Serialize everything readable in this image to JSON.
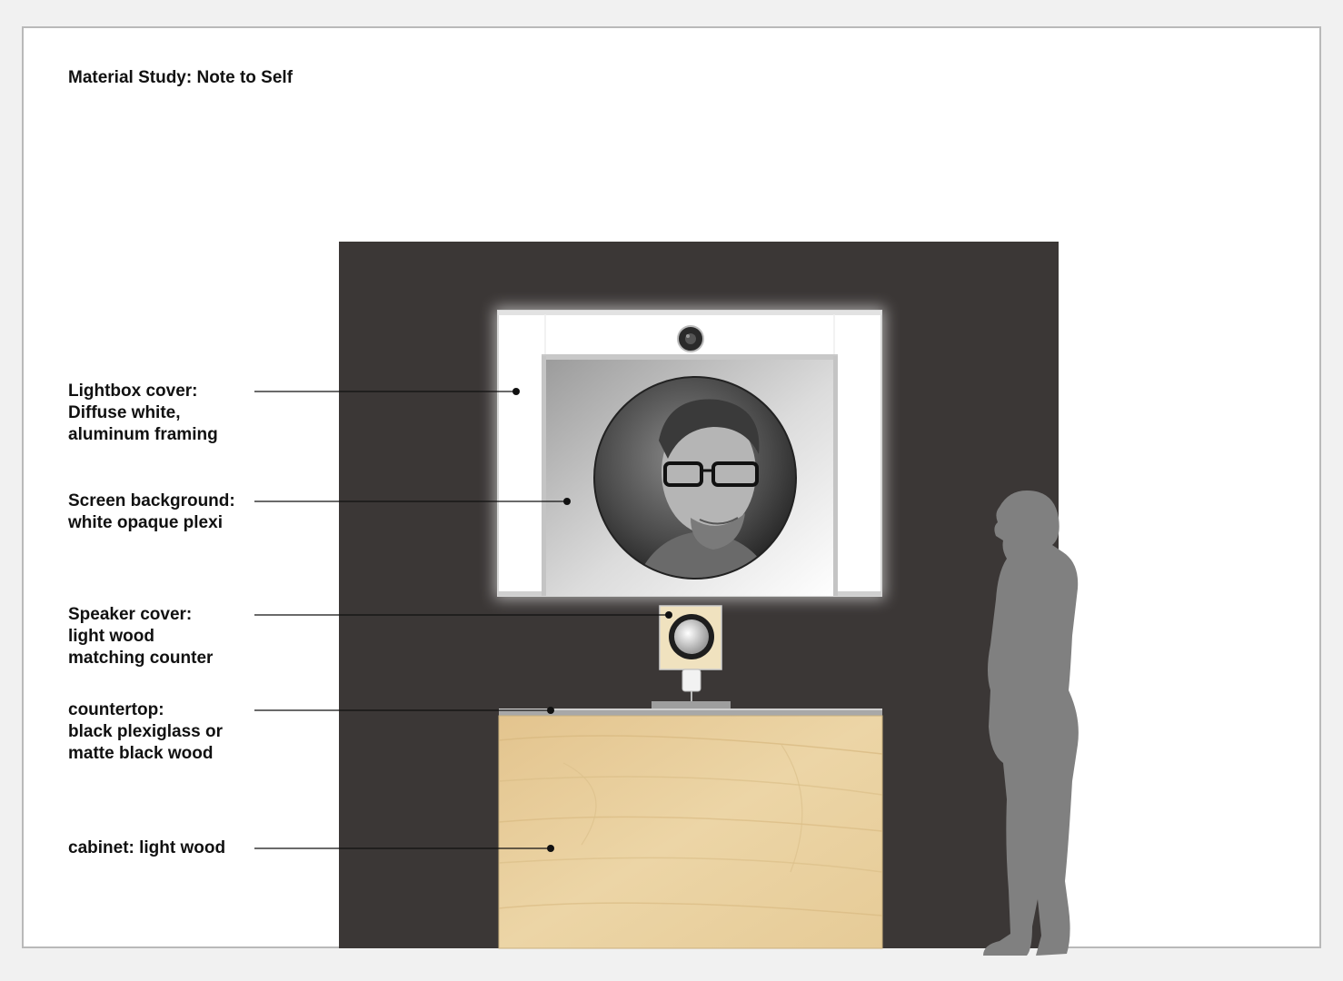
{
  "title": "Material Study: Note to Self",
  "callouts": [
    {
      "id": "lightbox-cover",
      "lines": [
        "Lightbox cover:",
        "Diffuse white,",
        "aluminum framing"
      ]
    },
    {
      "id": "screen-background",
      "lines": [
        "Screen background:",
        "white opaque plexi"
      ]
    },
    {
      "id": "speaker-cover",
      "lines": [
        "Speaker cover:",
        "light wood",
        "matching counter"
      ]
    },
    {
      "id": "countertop",
      "lines": [
        "countertop:",
        "black plexiglass or",
        "matte black wood"
      ]
    },
    {
      "id": "cabinet",
      "lines": [
        "cabinet: light wood"
      ]
    }
  ],
  "colors": {
    "wall": "#3b3736",
    "lightbox": "#ffffff",
    "wood": "#e8cf9c",
    "silhouette": "#808080",
    "sheet_border": "#b9b9b9"
  }
}
